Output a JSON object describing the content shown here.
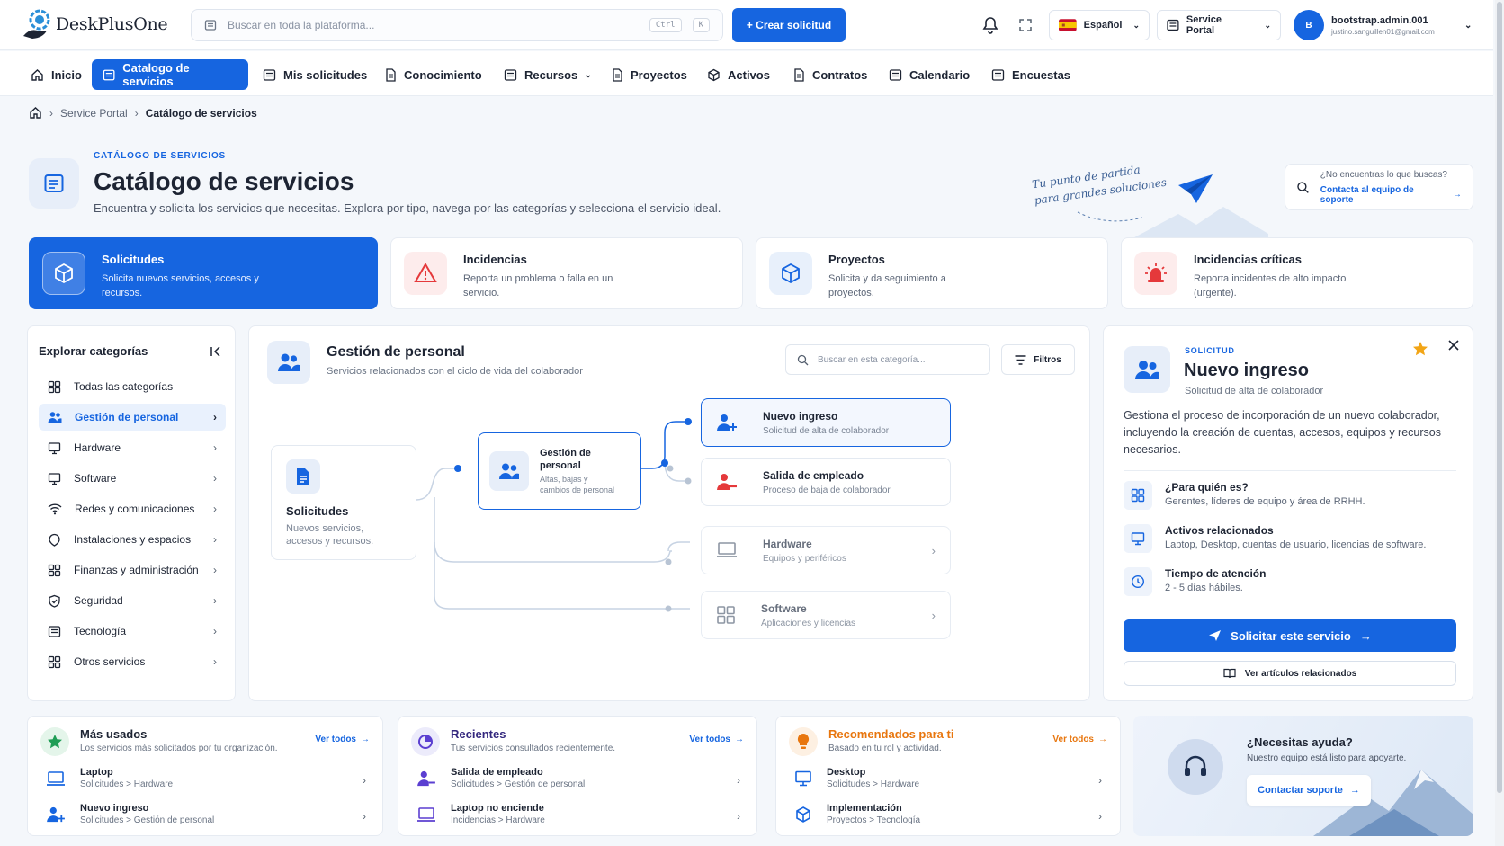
{
  "header": {
    "logo_text": "DeskPlusOne",
    "search_placeholder": "Buscar en toda la plataforma...",
    "kbd_ctrl": "Ctrl",
    "kbd_k": "K",
    "create_label": "+ Crear solicitud",
    "language_label": "Español",
    "portal_label": "Service Portal",
    "user_initial": "B",
    "user_name": "bootstrap.admin.001",
    "user_email": "justino.sanguillen01@gmail.com"
  },
  "nav": {
    "items": [
      {
        "label": "Inicio",
        "icon": "home-icon"
      },
      {
        "label": "Catalogo de servicios",
        "icon": "catalog-icon",
        "active": true
      },
      {
        "label": "Mis solicitudes",
        "icon": "list-icon"
      },
      {
        "label": "Conocimiento",
        "icon": "document-icon"
      },
      {
        "label": "Recursos",
        "icon": "list-icon",
        "dropdown": true
      },
      {
        "label": "Proyectos",
        "icon": "document-icon"
      },
      {
        "label": "Activos",
        "icon": "cube-icon"
      },
      {
        "label": "Contratos",
        "icon": "document-icon"
      },
      {
        "label": "Calendario",
        "icon": "list-icon"
      },
      {
        "label": "Encuestas",
        "icon": "list-icon"
      }
    ]
  },
  "breadcrumb": {
    "items": [
      "Service Portal",
      "Catálogo de servicios"
    ]
  },
  "page": {
    "eyebrow": "CATÁLOGO DE SERVICIOS",
    "title": "Catálogo de servicios",
    "subtitle": "Encuentra y solicita los servicios que necesitas. Explora por tipo, navega por las categorías y selecciona el servicio ideal.",
    "tagline_1": "Tu punto de partida",
    "tagline_2": "para grandes soluciones",
    "help_q": "¿No encuentras lo que buscas?",
    "help_link": "Contacta al equipo de soporte"
  },
  "types": [
    {
      "title": "Solicitudes",
      "desc": "Solicita nuevos servicios, accesos y recursos.",
      "active": true
    },
    {
      "title": "Incidencias",
      "desc": "Reporta un problema o falla en un servicio."
    },
    {
      "title": "Proyectos",
      "desc": "Solicita y da seguimiento a proyectos."
    },
    {
      "title": "Incidencias críticas",
      "desc": "Reporta incidentes de alto impacto (urgente)."
    }
  ],
  "categories": {
    "title": "Explorar categorías",
    "items": [
      {
        "label": "Todas las categorías",
        "chevron": false
      },
      {
        "label": "Gestión de personal",
        "active": true,
        "chevron": true
      },
      {
        "label": "Hardware",
        "chevron": true
      },
      {
        "label": "Software",
        "chevron": true
      },
      {
        "label": "Redes y comunicaciones",
        "chevron": true
      },
      {
        "label": "Instalaciones y espacios",
        "chevron": true
      },
      {
        "label": "Finanzas y administración",
        "chevron": true
      },
      {
        "label": "Seguridad",
        "chevron": true
      },
      {
        "label": "Tecnología",
        "chevron": true
      },
      {
        "label": "Otros servicios",
        "chevron": true
      }
    ]
  },
  "center": {
    "title": "Gestión de personal",
    "subtitle": "Servicios relacionados con el ciclo de vida del colaborador",
    "search_placeholder": "Buscar en esta categoría...",
    "filters_label": "Filtros",
    "root": {
      "title": "Solicitudes",
      "desc1": "Nuevos servicios,",
      "desc2": "accesos y recursos."
    },
    "mid": {
      "title1": "Gestión de",
      "title2": "personal",
      "desc1": "Altas, bajas y",
      "desc2": "cambios de personal"
    },
    "leaves": [
      {
        "title": "Nuevo ingreso",
        "desc": "Solicitud de alta de colaborador"
      },
      {
        "title": "Salida de empleado",
        "desc": "Proceso de baja de colaborador"
      },
      {
        "title": "Hardware",
        "desc": "Equipos y periféricos"
      },
      {
        "title": "Software",
        "desc": "Aplicaciones y licencias"
      }
    ]
  },
  "detail": {
    "eyebrow": "SOLICITUD",
    "title": "Nuevo ingreso",
    "subtitle": "Solicitud de alta de colaborador",
    "description": "Gestiona el proceso de incorporación de un nuevo colaborador, incluyendo la creación de cuentas, accesos, equipos y recursos necesarios.",
    "rows": [
      {
        "title": "¿Para quién es?",
        "text": "Gerentes, líderes de equipo y área de RRHH."
      },
      {
        "title": "Activos relacionados",
        "text": "Laptop, Desktop, cuentas de usuario, licencias de software."
      },
      {
        "title": "Tiempo de atención",
        "text": "2 - 5 días hábiles."
      }
    ],
    "primary_label": "Solicitar este servicio",
    "secondary_label": "Ver artículos relacionados"
  },
  "bottom": {
    "most_used": {
      "title": "Más usados",
      "subtitle": "Los servicios más solicitados por tu organización.",
      "see_all": "Ver todos",
      "items": [
        {
          "title": "Laptop",
          "path": "Solicitudes > Hardware"
        },
        {
          "title": "Nuevo ingreso",
          "path": "Solicitudes > Gestión de personal"
        }
      ]
    },
    "recent": {
      "title": "Recientes",
      "subtitle": "Tus servicios consultados recientemente.",
      "see_all": "Ver todos",
      "items": [
        {
          "title": "Salida de empleado",
          "path": "Solicitudes > Gestión de personal"
        },
        {
          "title": "Laptop no enciende",
          "path": "Incidencias > Hardware"
        }
      ]
    },
    "recommended": {
      "title": "Recomendados para ti",
      "subtitle": "Basado en tu rol y actividad.",
      "see_all": "Ver todos",
      "items": [
        {
          "title": "Desktop",
          "path": "Solicitudes > Hardware"
        },
        {
          "title": "Implementación",
          "path": "Proyectos > Tecnología"
        }
      ]
    },
    "help": {
      "title": "¿Necesitas ayuda?",
      "subtitle": "Nuestro equipo está listo para apoyarte.",
      "button": "Contactar soporte"
    }
  },
  "colors": {
    "primary": "#1665e0",
    "danger": "#e5393b",
    "success": "#1f9d55",
    "warning": "#e8760e",
    "purple": "#5b3fd1"
  }
}
